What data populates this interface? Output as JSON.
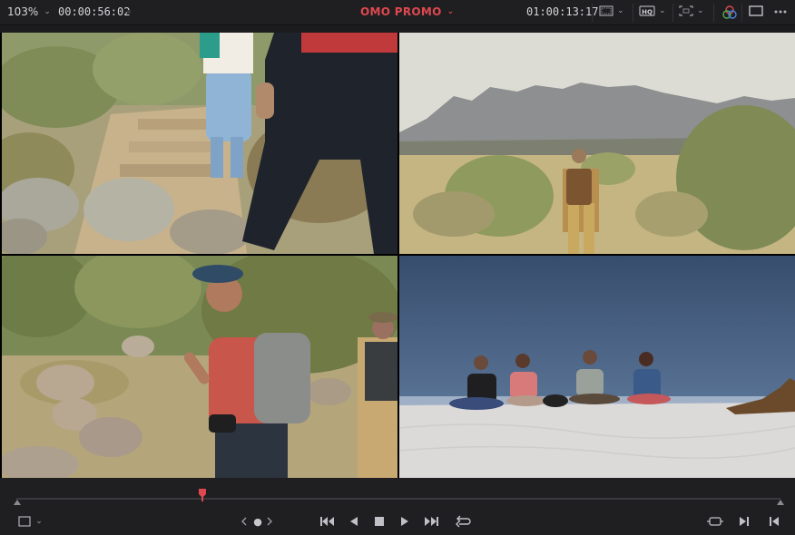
{
  "header": {
    "zoom": "103%",
    "source_timecode": "00:00:56:02",
    "project_title": "OMO PROMO",
    "record_timecode": "01:00:13:17",
    "icons": [
      "view-layout-icon",
      "hq-quality-icon",
      "safe-area-icon",
      "color-wheel-icon",
      "viewer-mode-icon",
      "more-options-icon"
    ],
    "hq_label": "HQ"
  },
  "viewer": {
    "layout": "2x2 multicam",
    "angles": [
      {
        "name": "hikers-on-stone-steps"
      },
      {
        "name": "hiker-with-backpack-mountains"
      },
      {
        "name": "hiker-red-shirt-cap"
      },
      {
        "name": "group-sitting-on-sand-dune"
      }
    ]
  },
  "transport": {
    "playhead_fraction": 0.243,
    "buttons": [
      "jump-to-start",
      "step-back",
      "stop",
      "play",
      "jump-to-end",
      "loop"
    ],
    "nav_dot": "●"
  },
  "colors": {
    "accent": "#e0484f",
    "background": "#1c1c1e"
  }
}
